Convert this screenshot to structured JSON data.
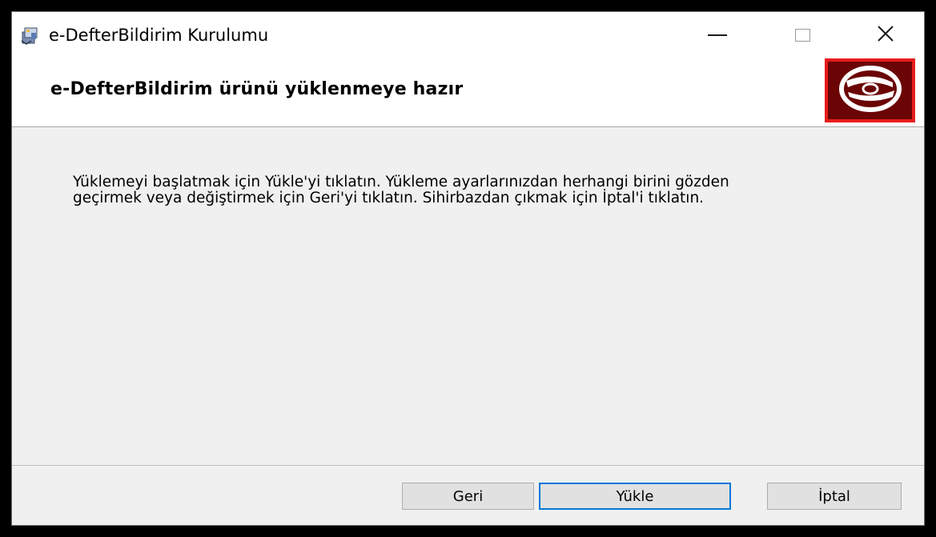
{
  "window": {
    "title": "e-DefterBildirim Kurulumu",
    "app_icon": "installer-box-icon"
  },
  "controls": {
    "minimize_icon": "minimize-icon",
    "maximize_icon": "maximize-icon",
    "close_icon": "close-icon",
    "close_glyph": "✕"
  },
  "header": {
    "title": "e-DefterBildirim ürünü yüklenmeye hazır",
    "banner_icon": "cd-disc-icon",
    "banner_color": "#e81c1c",
    "banner_inner_color": "#6b0505"
  },
  "main": {
    "line1": "Yüklemeyi başlatmak için Yükle'yi tıklatın. Yükleme ayarlarınızdan herhangi birini gözden",
    "line2": "geçirmek veya değiştirmek için Geri'yi tıklatın. Sihirbazdan çıkmak için İptal'i tıklatın."
  },
  "buttons": {
    "back": "Geri",
    "install": "Yükle",
    "cancel": "İptal"
  },
  "colors": {
    "accent": "#0078d7",
    "dialog_bg": "#f0f0f0"
  }
}
